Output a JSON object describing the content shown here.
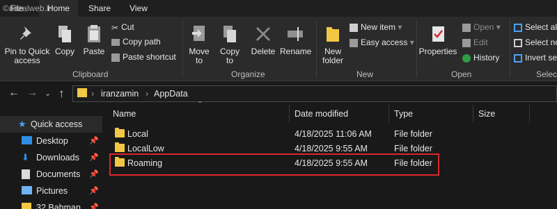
{
  "watermark": "©anzalweb.ir",
  "tabs": [
    "File",
    "Home",
    "Share",
    "View"
  ],
  "ribbon": {
    "clipboard": {
      "pin_label": "Pin to Quick access",
      "copy_label": "Copy",
      "paste_label": "Paste",
      "cut_label": "Cut",
      "copy_path_label": "Copy path",
      "paste_shortcut_label": "Paste shortcut",
      "group_label": "Clipboard"
    },
    "organize": {
      "move_to_label": "Move to",
      "copy_to_label": "Copy to",
      "delete_label": "Delete",
      "rename_label": "Rename",
      "group_label": "Organize"
    },
    "new": {
      "new_folder_label": "New folder",
      "new_item_label": "New item",
      "easy_access_label": "Easy access",
      "group_label": "New"
    },
    "open": {
      "properties_label": "Properties",
      "open_label": "Open",
      "edit_label": "Edit",
      "history_label": "History",
      "group_label": "Open"
    },
    "select": {
      "select_all_label": "Select al",
      "select_none_label": "Select no",
      "invert_label": "Invert se",
      "group_label": "Selec"
    }
  },
  "address": {
    "segments": [
      "iranzamin",
      "AppData"
    ]
  },
  "navpane": {
    "items": [
      {
        "label": "Quick access",
        "icon": "star-icon",
        "pinned": false
      },
      {
        "label": "Desktop",
        "icon": "desktop-icon",
        "pinned": true
      },
      {
        "label": "Downloads",
        "icon": "download-icon",
        "pinned": true
      },
      {
        "label": "Documents",
        "icon": "document-icon",
        "pinned": true
      },
      {
        "label": "Pictures",
        "icon": "picture-icon",
        "pinned": true
      },
      {
        "label": "32 Bahman",
        "icon": "folder-icon",
        "pinned": true
      }
    ]
  },
  "columns": [
    "Name",
    "Date modified",
    "Type",
    "Size"
  ],
  "rows": [
    {
      "name": "Local",
      "date": "4/18/2025 11:06 AM",
      "type": "File folder"
    },
    {
      "name": "LocalLow",
      "date": "4/18/2025 9:55 AM",
      "type": "File folder"
    },
    {
      "name": "Roaming",
      "date": "4/18/2025 9:55 AM",
      "type": "File folder"
    }
  ],
  "colors": {
    "accent_highlight": "#d9272e",
    "folder": "#f2c744"
  }
}
